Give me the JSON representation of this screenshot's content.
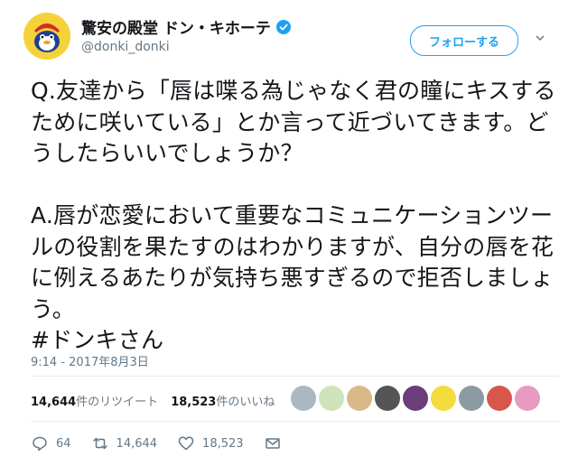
{
  "account": {
    "name": "驚安の殿堂 ドン・キホーテ",
    "handle": "@donki_donki",
    "follow_label": "フォローする"
  },
  "tweet": {
    "text": "Q.友達から「唇は喋る為じゃなく君の瞳にキスするために咲いている」とか言って近づいてきます。どうしたらいいでしょうか？\n\nA.唇が恋愛において重要なコミュニケーションツールの役割を果たすのはわかりますが、自分の唇を花に例えるあたりが気持ち悪すぎるので拒否しましょう。\n#ドンキさん",
    "timestamp": "9:14 - 2017年8月3日"
  },
  "stats": {
    "retweets_count": "14,644",
    "retweets_label": "件のリツイート",
    "likes_count": "18,523",
    "likes_label": "件のいいね"
  },
  "likers": [
    {
      "icon": "default-avatar",
      "color": "#aab8c2"
    },
    {
      "icon": "cartoon-avatar",
      "color": "#cfe3b8"
    },
    {
      "icon": "desert-avatar",
      "color": "#d9b98a"
    },
    {
      "icon": "bw-pattern-avatar",
      "color": "#555555"
    },
    {
      "icon": "purple-avatar",
      "color": "#6b3d7a"
    },
    {
      "icon": "sponge-avatar",
      "color": "#f3dc3e"
    },
    {
      "icon": "animal-avatar",
      "color": "#8c9aa3"
    },
    {
      "icon": "festive-avatar",
      "color": "#d8574b"
    },
    {
      "icon": "pink-avatar",
      "color": "#e89ac1"
    }
  ],
  "actions": {
    "replies": "64",
    "retweets": "14,644",
    "likes": "18,523"
  },
  "colors": {
    "accent": "#1da1f2",
    "text": "#14171a",
    "muted": "#657786",
    "divider": "#e6ecf0"
  }
}
